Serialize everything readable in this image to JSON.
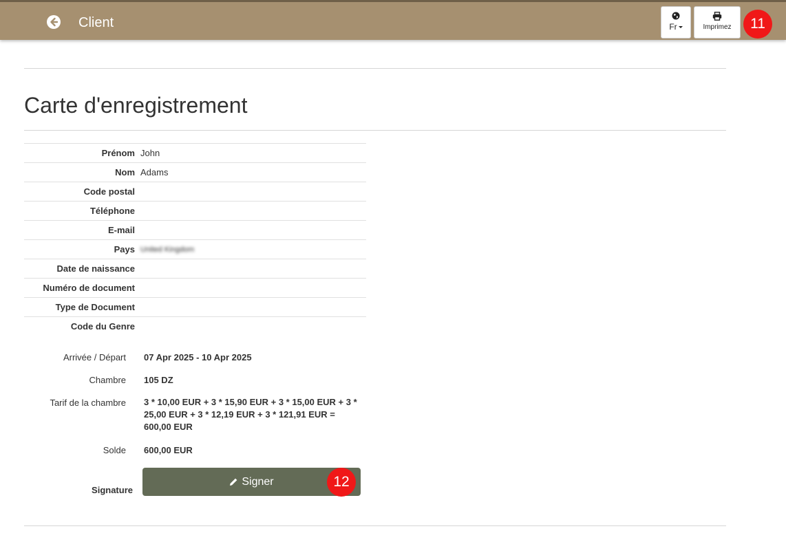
{
  "header": {
    "title": "Client",
    "language_label": "Fr",
    "print_label": "Imprimez",
    "badge_print": "11"
  },
  "main": {
    "title": "Carte d'enregistrement",
    "fields": [
      {
        "label": "Prénom",
        "value": "John"
      },
      {
        "label": "Nom",
        "value": "Adams"
      },
      {
        "label": "Code postal",
        "value": ""
      },
      {
        "label": "Téléphone",
        "value": ""
      },
      {
        "label": "E-mail",
        "value": ""
      },
      {
        "label": "Pays",
        "value": "United Kingdom"
      },
      {
        "label": "Date de naissance",
        "value": ""
      },
      {
        "label": "Numéro de document",
        "value": ""
      },
      {
        "label": "Type de Document",
        "value": ""
      },
      {
        "label": "Code du Genre",
        "value": ""
      }
    ],
    "stay": {
      "dates_label": "Arrivée / Départ",
      "dates_value": "07 Apr 2025 - 10 Apr 2025",
      "room_label": "Chambre",
      "room_value": "105 DZ",
      "rate_label": "Tarif de la chambre",
      "rate_value": "3 * 10,00 EUR + 3 * 15,90 EUR + 3 * 15,00 EUR + 3 * 25,00 EUR + 3 * 12,19 EUR + 3 * 121,91 EUR = 600,00 EUR",
      "balance_label": "Solde",
      "balance_value": "600,00 EUR"
    },
    "signature_label": "Signature",
    "sign_button_label": "Signer",
    "badge_sign": "12"
  },
  "colors": {
    "header_bg": "#a69070",
    "sign_button_bg": "#636b56",
    "badge": "#f01818"
  }
}
